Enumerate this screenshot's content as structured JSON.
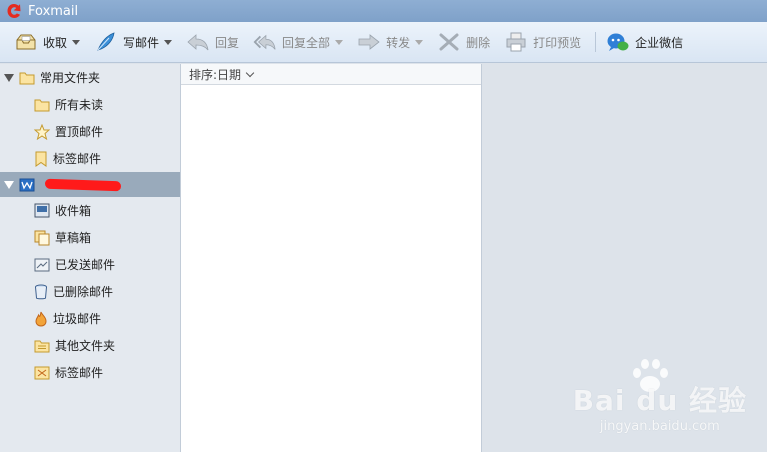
{
  "window": {
    "title": "Foxmail"
  },
  "toolbar": {
    "receive": "收取",
    "compose": "写邮件",
    "reply": "回复",
    "reply_all": "回复全部",
    "forward": "转发",
    "delete": "删除",
    "print_preview": "打印预览",
    "enterprise_wechat": "企业微信"
  },
  "sidebar": {
    "common_folders": {
      "title": "常用文件夹",
      "items": [
        "所有未读",
        "置顶邮件",
        "标签邮件"
      ]
    },
    "account": {
      "folders": [
        "收件箱",
        "草稿箱",
        "已发送邮件",
        "已删除邮件",
        "垃圾邮件",
        "其他文件夹",
        "标签邮件"
      ]
    }
  },
  "list": {
    "sort_label": "排序:日期"
  },
  "watermark": {
    "main": "Bai du 经验",
    "sub": "jingyan.baidu.com"
  },
  "colors": {
    "titlebar": "#7fa1c9",
    "sidebar": "#e4e9ef",
    "account_header": "#99aabb",
    "preview_bg": "#dde3ea",
    "redaction": "#ff1a1a"
  }
}
